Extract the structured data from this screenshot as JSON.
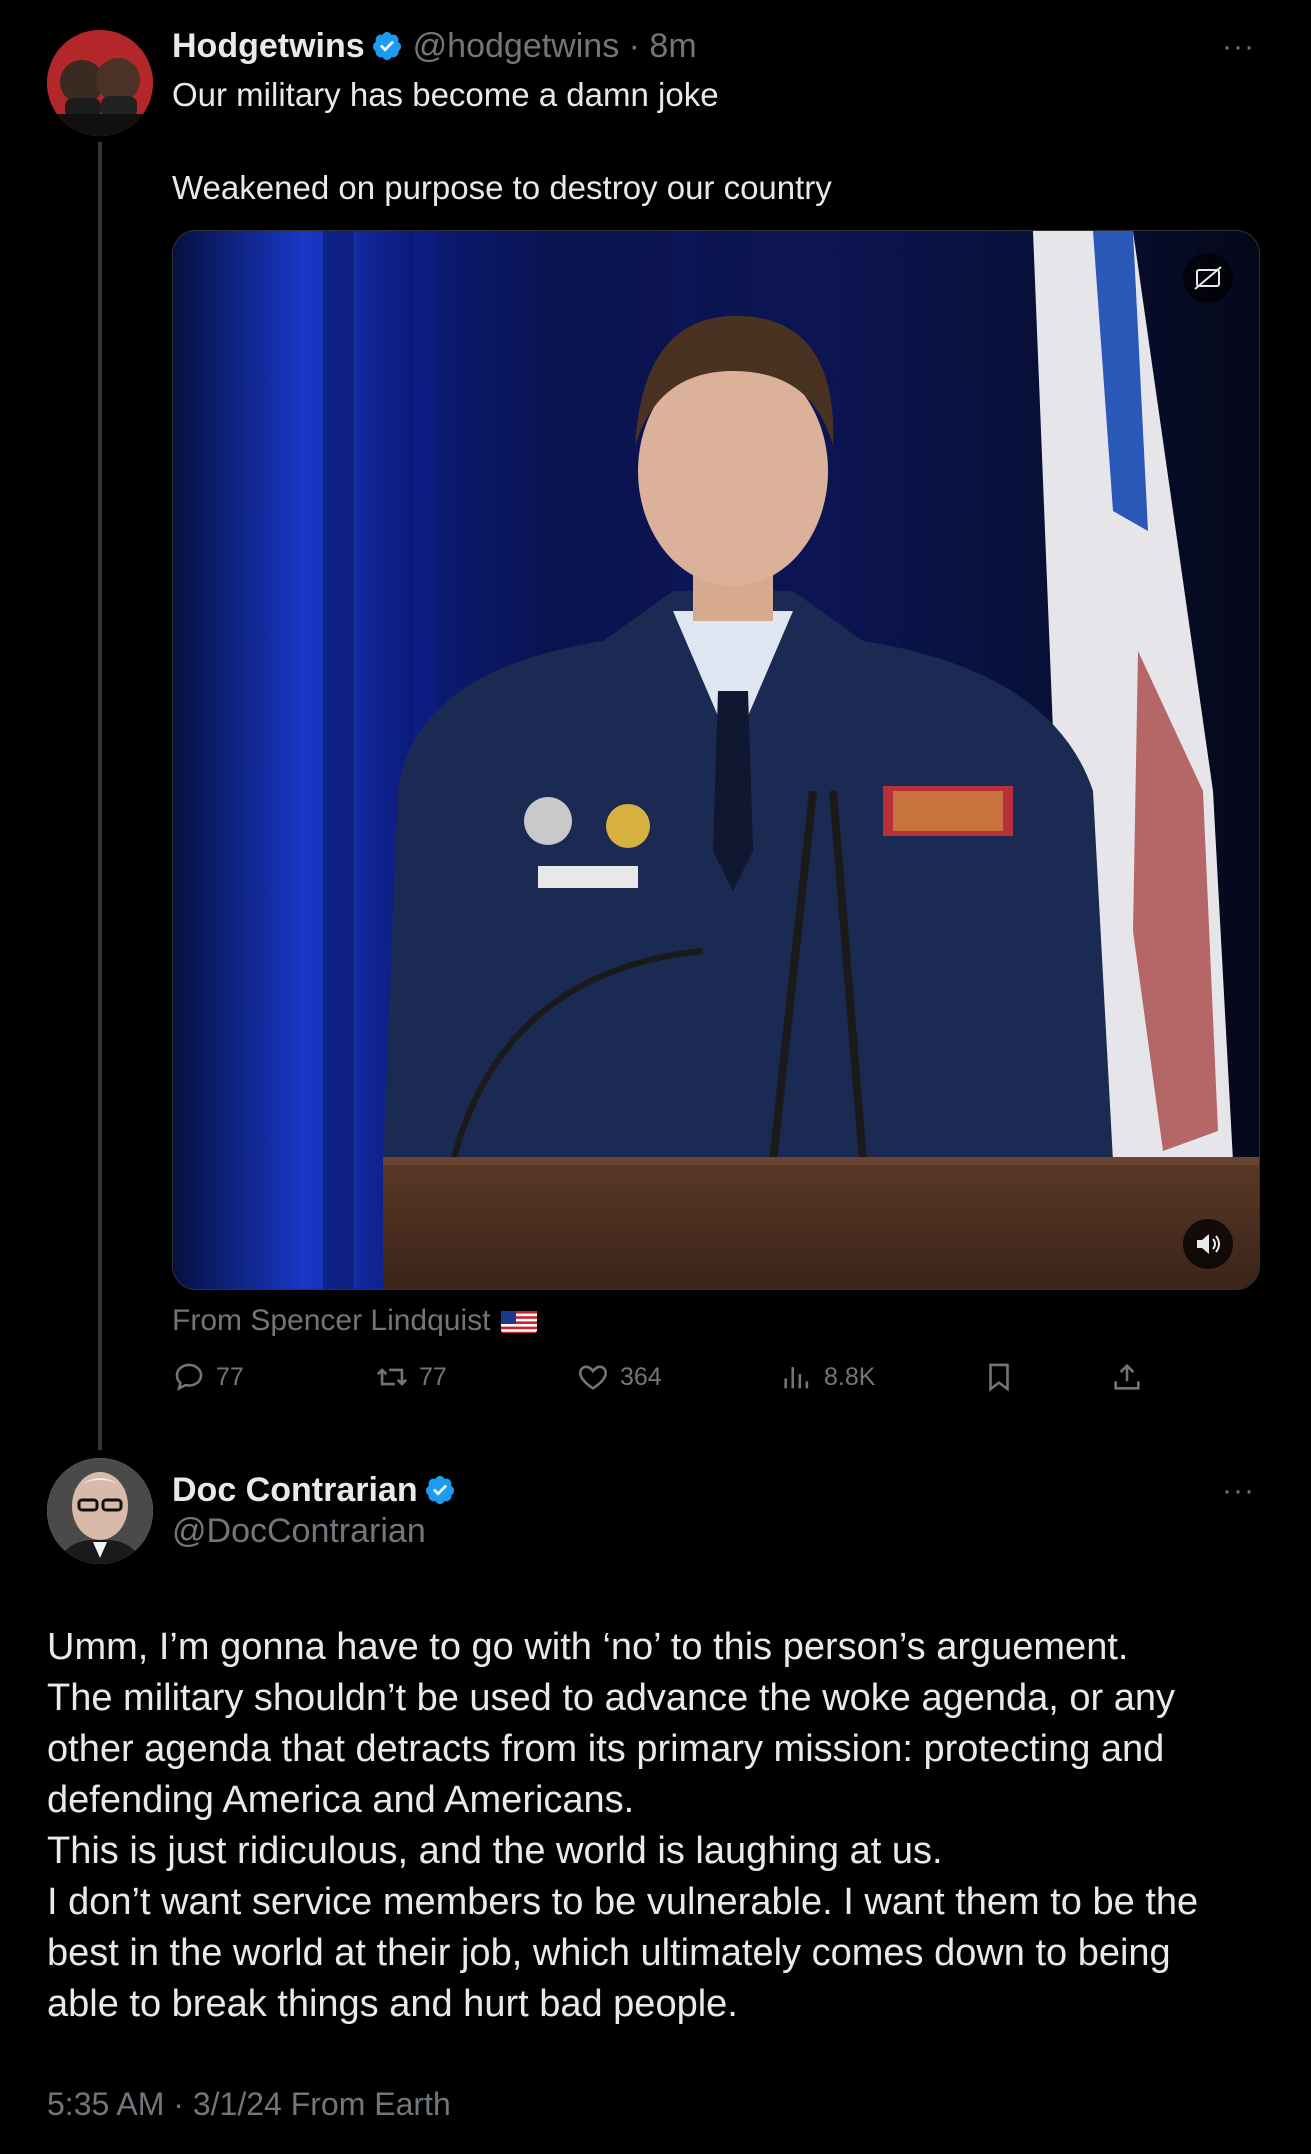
{
  "parent_tweet": {
    "author_name": "Hodgetwins",
    "verified": true,
    "handle": "@hodgetwins",
    "time_sep": " · ",
    "time": "8m",
    "more": "···",
    "text_line1": "Our military has become a damn joke",
    "text_line2": "Weakened on purpose to destroy our country",
    "media": {
      "kind": "video",
      "scene": "speaker at podium in dark blue uniform, blue curtain, flag"
    },
    "source_prefix": "From ",
    "source_name": "Spencer Lindquist",
    "source_flag": "us-flag",
    "actions": {
      "replies": "77",
      "reposts": "77",
      "likes": "364",
      "views": "8.8K"
    }
  },
  "main_tweet": {
    "author_name": "Doc Contrarian",
    "verified": true,
    "handle": "@DocContrarian",
    "more": "···",
    "lines": [
      "Umm, I’m gonna have to go with ‘no’ to this person’s arguement.",
      "The military shouldn’t be used to advance the woke agenda, or any",
      "other agenda that detracts from its primary mission: protecting and",
      "defending America and Americans.",
      "This is just ridiculous, and the world is laughing at us.",
      "I don’t want service members to be vulnerable. I want them to be the",
      "best in the world at their job, which ultimately comes down to being",
      "able to break things and hurt bad people."
    ],
    "timestamp": "5:35 AM · 3/1/24 From Earth"
  },
  "icons": {
    "verified": "verified-badge-icon",
    "reply": "reply-icon",
    "repost": "repost-icon",
    "like": "heart-icon",
    "views": "views-icon",
    "bookmark": "bookmark-icon",
    "share": "share-icon",
    "mute": "speaker-icon",
    "autoplay": "autoplay-off-icon"
  },
  "colors": {
    "background": "#000000",
    "text": "#e7e9ea",
    "muted": "#71767b",
    "verified": "#1d9bf0"
  }
}
